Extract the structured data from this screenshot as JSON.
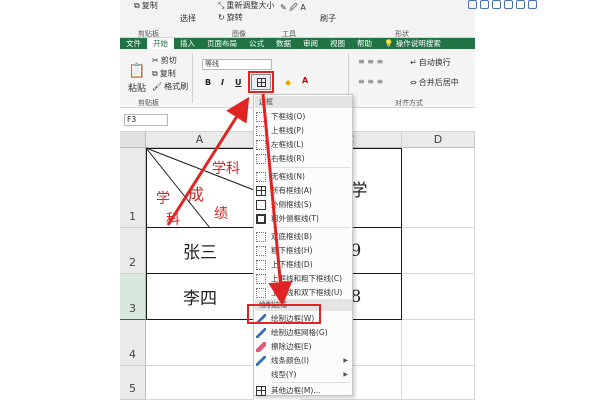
{
  "top_ribbon": {
    "items": [
      "复制",
      "重新调整大小",
      "旋转",
      "选择",
      "刷子"
    ],
    "groups": [
      "剪贴板",
      "图像",
      "工具",
      "形状"
    ]
  },
  "menubar": {
    "tabs": [
      "文件",
      "开始",
      "插入",
      "页面布局",
      "公式",
      "数据",
      "审阅",
      "视图",
      "帮助",
      "操作说明搜索"
    ]
  },
  "ribbon": {
    "cut": "剪切",
    "paste": "粘贴",
    "copy": "复制",
    "format_painter": "格式刷",
    "clipboard_group": "剪贴板",
    "font_name": "等线",
    "bold": "B",
    "italic": "I",
    "underline": "U",
    "wrap_text": "自动换行",
    "merge_center": "合并后居中",
    "align_group": "对齐方式"
  },
  "name_box": "F3",
  "columns": [
    "A",
    "B",
    "C",
    "D"
  ],
  "rows": [
    "1",
    "2",
    "3",
    "4",
    "5"
  ],
  "cells": {
    "header_subject_1": "学",
    "header_subject_2": "科",
    "header_grade": "成",
    "header_grade_2": "绩",
    "header_xueke": "学科",
    "c1": "数学",
    "a2": "张三",
    "c2": "99",
    "a3": "李四",
    "c3": "18"
  },
  "border_menu": {
    "section_borders": "边框",
    "items": [
      "下框线(O)",
      "上框线(P)",
      "左框线(L)",
      "右框线(R)",
      "无框线(N)",
      "所有框线(A)",
      "外侧框线(S)",
      "粗外侧框线(T)",
      "双底框线(B)",
      "粗下框线(H)",
      "上下框线(D)",
      "上框线和粗下框线(C)",
      "上框线和双下框线(U)"
    ],
    "section_draw": "绘制边框",
    "draw_items": [
      "绘制边框(W)",
      "绘制边框网格(G)",
      "擦除边框(E)",
      "线条颜色(I)",
      "线型(Y)",
      "其他边框(M)..."
    ]
  },
  "colors": {
    "excel_green": "#217346",
    "annotation_red": "#e02424"
  }
}
